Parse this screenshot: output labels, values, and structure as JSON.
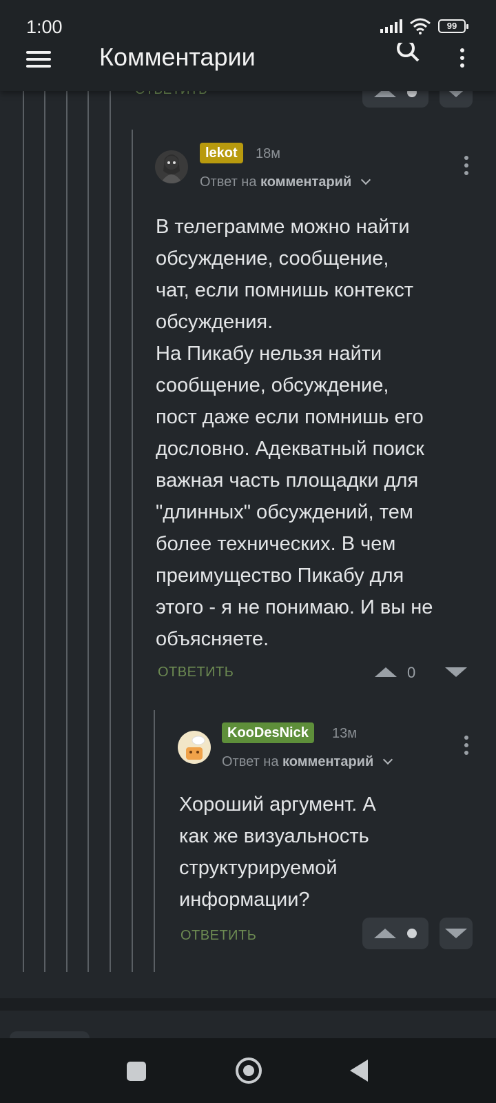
{
  "status_bar": {
    "time": "1:00",
    "battery": "99"
  },
  "app_bar": {
    "title": "Комментарии"
  },
  "previous_comment": {
    "reply_label": "ОТВЕТИТЬ"
  },
  "comments": [
    {
      "username": "lekot",
      "username_color": "#b89a0e",
      "time": "18м",
      "reply_to_prefix": "Ответ на",
      "reply_to_target": "комментарий",
      "text": "В телеграмме можно найти\nобсуждение, сообщение,\nчат, если помнишь контекст\nобсуждения.\nНа Пикабу нельзя найти\nсообщение, обсуждение,\nпост даже если помнишь его\nдословно. Адекватный поиск\nважная часть площадки для\n\"длинных\" обсуждений, тем\nболее технических. В чем\nпреимущество Пикабу для\nэтого - я не понимаю. И вы не\nобъясняете.",
      "reply_label": "ОТВЕТИТЬ",
      "rating": "0"
    },
    {
      "username": "KooDesNick",
      "username_color": "#5e8f3a",
      "time": "13м",
      "reply_to_prefix": "Ответ на",
      "reply_to_target": "комментарий",
      "text": "Хороший аргумент. А\nкак же визуальность\nструктурируемой\nинформации?",
      "reply_label": "ОТВЕТИТЬ"
    }
  ],
  "colors": {
    "background": "#23272b",
    "accent_green": "#6c8a52"
  }
}
